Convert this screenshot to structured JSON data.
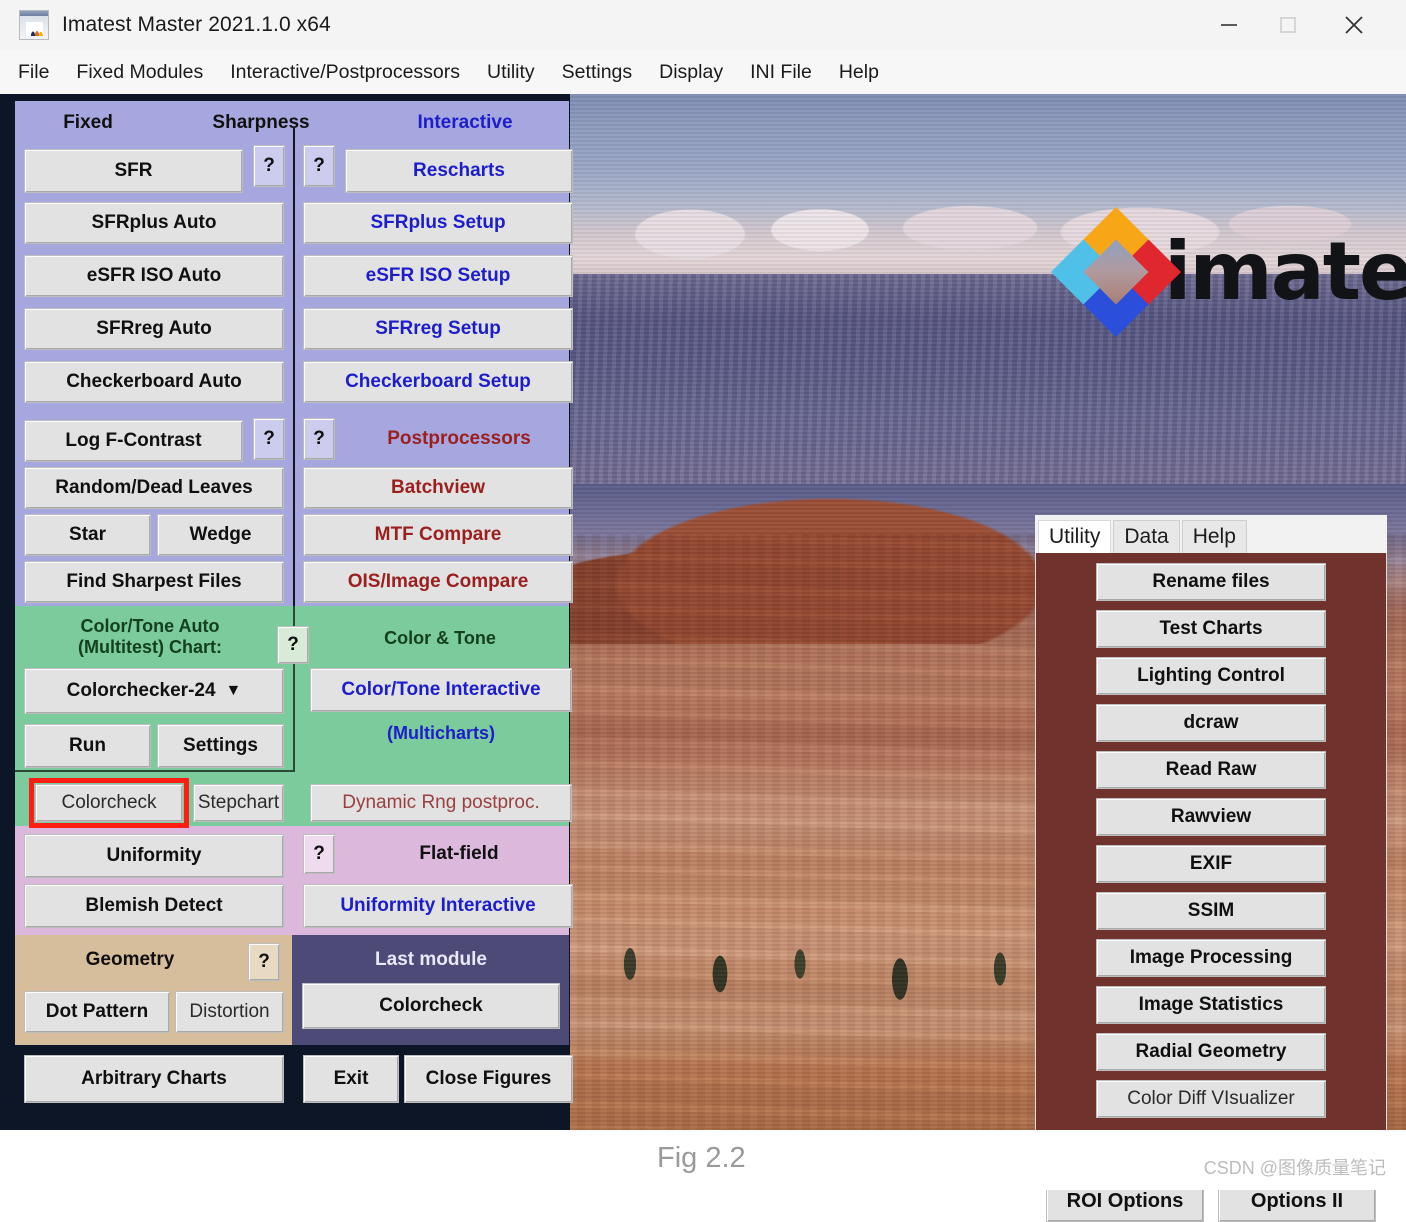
{
  "window": {
    "title": "Imatest Master 2021.1.0 x64",
    "app_icon": "matlab-icon",
    "controls": {
      "minimize": "minimize-icon",
      "maximize": "maximize-icon",
      "close": "close-icon"
    }
  },
  "menubar": {
    "items": [
      "File",
      "Fixed Modules",
      "Interactive/Postprocessors",
      "Utility",
      "Settings",
      "Display",
      "INI File",
      "Help"
    ]
  },
  "colors": {
    "sharpness_bg": "#a7a7e0",
    "colortone_bg": "#7bcb9d",
    "flatfield_bg": "#dcb8dc",
    "geometry_bg": "#d6bd9b",
    "lastmodule_bg": "#4e4a78",
    "utility_bg": "#70322c",
    "highlight": "#ff1d14",
    "blue_text": "#1d1dcc",
    "darkred_text": "#9b1f1f"
  },
  "left_panel": {
    "sharpness": {
      "header": {
        "fixed": "Fixed",
        "title": "Sharpness",
        "interactive": "Interactive"
      },
      "fixed_buttons": [
        "SFR",
        "SFRplus Auto",
        "eSFR ISO Auto",
        "SFRreg Auto",
        "Checkerboard Auto"
      ],
      "interactive_buttons": [
        "Rescharts",
        "SFRplus Setup",
        "eSFR ISO Setup",
        "SFRreg Setup",
        "Checkerboard Setup"
      ],
      "help_left": "?",
      "help_right": "?"
    },
    "postprocessors": {
      "header": "Postprocessors",
      "fixed_buttons": [
        "Log F-Contrast",
        "Random/Dead Leaves",
        "Star",
        "Wedge",
        "Find Sharpest Files"
      ],
      "interactive_buttons": [
        "Batchview",
        "MTF Compare",
        "OIS/Image Compare"
      ],
      "help_left": "?",
      "help_right": "?"
    },
    "color_tone": {
      "header_line1": "Color/Tone Auto",
      "header_line2": "(Multitest)   Chart:",
      "help": "?",
      "right_header": "Color & Tone",
      "chart_select": "Colorchecker-24",
      "chart_caret": "chevron-down-icon",
      "run": "Run",
      "settings": "Settings",
      "colorcheck": "Colorcheck",
      "stepchart": "Stepchart",
      "interactive": "Color/Tone Interactive",
      "multicharts": "(Multicharts)",
      "dynamic_rng": "Dynamic Rng postproc."
    },
    "flat_field": {
      "header": "Flat-field",
      "help": "?",
      "uniformity": "Uniformity",
      "blemish_detect": "Blemish Detect",
      "uniformity_interactive": "Uniformity Interactive"
    },
    "geometry": {
      "header": "Geometry",
      "help": "?",
      "dot_pattern": "Dot Pattern",
      "distortion": "Distortion",
      "last_module_header": "Last module",
      "last_module_button": "Colorcheck"
    },
    "bottom": {
      "arbitrary_charts": "Arbitrary Charts",
      "exit": "Exit",
      "close_figures": "Close Figures"
    }
  },
  "utility_panel": {
    "tabs": [
      "Utility",
      "Data",
      "Help"
    ],
    "active_tab": "Utility",
    "buttons": [
      "Rename files",
      "Test Charts",
      "Lighting Control",
      "dcraw",
      "Read Raw",
      "Rawview",
      "EXIF",
      "SSIM",
      "Image Processing",
      "Image Statistics",
      "Radial Geometry",
      "Color Diff VIsualizer"
    ],
    "plain_button": "Color Diff VIsualizer",
    "help_buttons": [
      "Utility ?",
      "Data ?",
      "Help ?"
    ],
    "option_buttons": [
      "ROI Options",
      "Options II"
    ]
  },
  "branding": {
    "logo_word": "imatest",
    "logo_mark": "imatest-diamond-logo",
    "registered": "®"
  },
  "caption": {
    "figure": "Fig 2.2",
    "watermark": "CSDN @图像质量笔记"
  }
}
